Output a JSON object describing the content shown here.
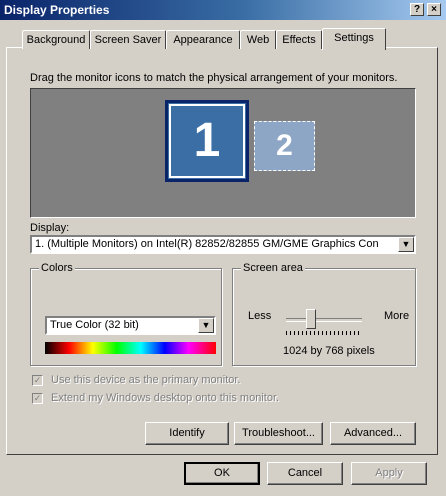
{
  "window": {
    "title": "Display Properties",
    "help_label": "?",
    "close_label": "×"
  },
  "tabs": [
    {
      "label": "Background"
    },
    {
      "label": "Screen Saver"
    },
    {
      "label": "Appearance"
    },
    {
      "label": "Web"
    },
    {
      "label": "Effects"
    },
    {
      "label": "Settings"
    }
  ],
  "active_tab": "Settings",
  "settings": {
    "instruction": "Drag the monitor icons to match the physical arrangement of your monitors.",
    "monitors": [
      {
        "label": "1"
      },
      {
        "label": "2"
      }
    ],
    "display_label": "Display:",
    "display_value": "1. (Multiple Monitors) on Intel(R) 82852/82855 GM/GME Graphics Con",
    "colors": {
      "group_label": "Colors",
      "value": "True Color (32 bit)"
    },
    "screen_area": {
      "group_label": "Screen area",
      "less_label": "Less",
      "more_label": "More",
      "resolution": "1024 by 768 pixels",
      "slider_position": 0.3
    },
    "primary_checkbox": {
      "label": "Use this device as the primary monitor.",
      "checked": true,
      "disabled": true
    },
    "extend_checkbox": {
      "label": "Extend my Windows desktop onto this monitor.",
      "checked": true,
      "disabled": true
    },
    "buttons": {
      "identify": "Identify",
      "troubleshoot": "Troubleshoot...",
      "advanced": "Advanced..."
    }
  },
  "footer": {
    "ok": "OK",
    "cancel": "Cancel",
    "apply": "Apply"
  }
}
